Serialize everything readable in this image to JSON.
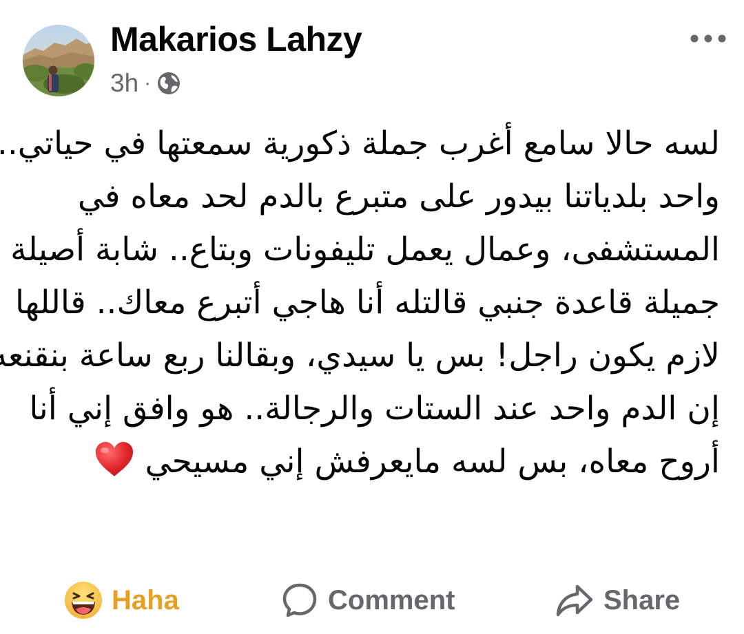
{
  "post": {
    "author_name": "Makarios Lahzy",
    "timestamp": "3h",
    "separator": "·",
    "audience_icon": "globe-icon",
    "more_icon": "more-options-icon",
    "text_lines": [
      "لسه حالا سامع أغرب جملة ذكورية سمعتها في حياتي..",
      "واحد بلدياتنا بيدور على متبرع بالدم لحد معاه في",
      "المستشفى، وعمال يعمل تليفونات وبتاع.. شابة أصيلة",
      "جميلة قاعدة جنبي قالتله أنا هاجي أتبرع معاك.. قاللها",
      "لازم يكون راجل! بس يا سيدي، وبقالنا ربع ساعة بنقنعه",
      "إن الدم واحد عند الستات والرجالة.. هو وافق إني أنا",
      "أروح معاه، بس لسه مايعرفش إني مسيحي"
    ],
    "emoji": "red-heart-icon"
  },
  "actions": {
    "reaction_label": "Haha",
    "reaction_icon": "haha-emoji-icon",
    "comment_label": "Comment",
    "comment_icon": "comment-bubble-icon",
    "share_label": "Share",
    "share_icon": "share-arrow-icon"
  },
  "colors": {
    "text": "#050505",
    "secondary": "#65676b",
    "haha": "#e4a124",
    "heart": "#e2262c"
  }
}
